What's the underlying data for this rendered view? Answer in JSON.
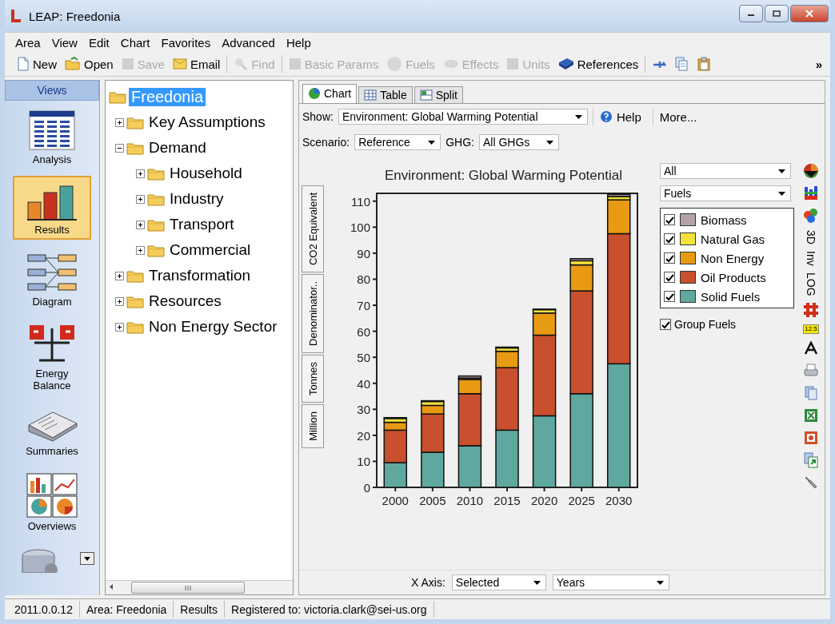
{
  "window": {
    "title": "LEAP: Freedonia"
  },
  "menu": [
    "Area",
    "View",
    "Edit",
    "Chart",
    "Favorites",
    "Advanced",
    "Help"
  ],
  "toolbar": [
    {
      "kind": "button",
      "label": "New",
      "disabled": false
    },
    {
      "kind": "button",
      "label": "Open",
      "disabled": false
    },
    {
      "kind": "button",
      "label": "Save",
      "disabled": true
    },
    {
      "kind": "button",
      "label": "Email",
      "disabled": false
    },
    {
      "kind": "separator"
    },
    {
      "kind": "button",
      "label": "Find",
      "disabled": true
    },
    {
      "kind": "separator"
    },
    {
      "kind": "button",
      "label": "Basic Params",
      "disabled": true
    },
    {
      "kind": "button",
      "label": "Fuels",
      "disabled": true
    },
    {
      "kind": "button",
      "label": "Effects",
      "disabled": true
    },
    {
      "kind": "button",
      "label": "Units",
      "disabled": true
    },
    {
      "kind": "button",
      "label": "References",
      "disabled": false
    },
    {
      "kind": "separator"
    },
    {
      "kind": "button",
      "disabled": false
    },
    {
      "kind": "button",
      "disabled": false
    },
    {
      "kind": "button",
      "disabled": false
    },
    {
      "kind": "more",
      "label": "»"
    }
  ],
  "views": {
    "header": "Views",
    "items": [
      {
        "label": "Analysis",
        "selected": false
      },
      {
        "label": "Results",
        "selected": true
      },
      {
        "label": "Diagram",
        "selected": false
      },
      {
        "label": "Energy Balance",
        "selected": false
      },
      {
        "label": "Summaries",
        "selected": false
      },
      {
        "label": "Overviews",
        "selected": false
      }
    ]
  },
  "tree": {
    "label": "Freedonia",
    "selected": true,
    "children": [
      {
        "label": "Key Assumptions",
        "expanded": false,
        "selected": false
      },
      {
        "label": "Demand",
        "expanded": true,
        "selected": false,
        "children": [
          {
            "label": "Household",
            "expanded": false,
            "selected": false
          },
          {
            "label": "Industry",
            "expanded": false,
            "selected": false
          },
          {
            "label": "Transport",
            "expanded": false,
            "selected": false
          },
          {
            "label": "Commercial",
            "expanded": false,
            "selected": false
          }
        ]
      },
      {
        "label": "Transformation",
        "expanded": false,
        "selected": false
      },
      {
        "label": "Resources",
        "expanded": false,
        "selected": false
      },
      {
        "label": "Non Energy Sector",
        "expanded": false,
        "selected": false
      }
    ]
  },
  "tabs": [
    {
      "label": "Chart",
      "selected": true
    },
    {
      "label": "Table",
      "selected": false
    },
    {
      "label": "Split",
      "selected": false
    }
  ],
  "show": {
    "label": "Show:",
    "value": "Environment: Global Warming Potential",
    "help": "Help",
    "more": "More..."
  },
  "scenario": {
    "label": "Scenario:",
    "value": "Reference"
  },
  "ghg": {
    "label": "GHG:",
    "value": "All GHGs"
  },
  "side_tabs": [
    "CO2 Equivalent",
    "Denominator..",
    "Tonnes",
    "Million"
  ],
  "chart": {
    "chart_data": {
      "type": "bar",
      "title": "Environment: Global Warming Potential",
      "stacked": true,
      "categories": [
        "2000",
        "2005",
        "2010",
        "2015",
        "2020",
        "2025",
        "2030"
      ],
      "ylim": [
        0,
        113
      ],
      "yticks": [
        0,
        10,
        20,
        30,
        40,
        50,
        60,
        70,
        80,
        90,
        100,
        110
      ],
      "series": [
        {
          "name": "Biomass",
          "color": "#b3a2a6",
          "values": [
            0.3,
            0.3,
            0.8,
            0.3,
            0.2,
            0.8,
            0.8
          ]
        },
        {
          "name": "Natural Gas",
          "color": "#f3e23c",
          "values": [
            1.5,
            1.5,
            0.5,
            1.3,
            1.3,
            1.6,
            1.3
          ]
        },
        {
          "name": "Non Energy",
          "color": "#e89a12",
          "values": [
            3,
            3.3,
            5.5,
            6.3,
            8.5,
            10,
            13
          ]
        },
        {
          "name": "Oil Products",
          "color": "#c8502e",
          "values": [
            12.5,
            14.7,
            20,
            24,
            31,
            39.5,
            50
          ]
        },
        {
          "name": "Solid Fuels",
          "color": "#5fa8a0",
          "values": [
            9.5,
            13.5,
            16,
            22,
            27.5,
            36,
            47.5
          ]
        }
      ]
    },
    "selectors": [
      "All",
      "Fuels"
    ],
    "legend": [
      {
        "checked": true
      },
      {
        "checked": true
      },
      {
        "checked": true
      },
      {
        "checked": true
      },
      {
        "checked": true
      }
    ],
    "group_fuels": {
      "label": "Group Fuels",
      "checked": true
    }
  },
  "chart_tools": [
    {
      "kind": "icon"
    },
    {
      "kind": "icon"
    },
    {
      "kind": "icon"
    },
    {
      "kind": "text",
      "label": "3D"
    },
    {
      "kind": "text",
      "label": "Inv"
    },
    {
      "kind": "text",
      "label": "LOG"
    },
    {
      "kind": "icon"
    },
    {
      "kind": "badge",
      "label": "12.5"
    },
    {
      "kind": "icon"
    },
    {
      "kind": "icon"
    },
    {
      "kind": "icon"
    },
    {
      "kind": "icon"
    },
    {
      "kind": "icon"
    },
    {
      "kind": "icon"
    },
    {
      "kind": "icon"
    }
  ],
  "x_axis": {
    "label": "X Axis:",
    "value": "Selected",
    "unit": "Years"
  },
  "status_bar": [
    "2011.0.0.12",
    "Area: Freedonia",
    "Results",
    "Registered to: victoria.clark@sei-us.org"
  ]
}
